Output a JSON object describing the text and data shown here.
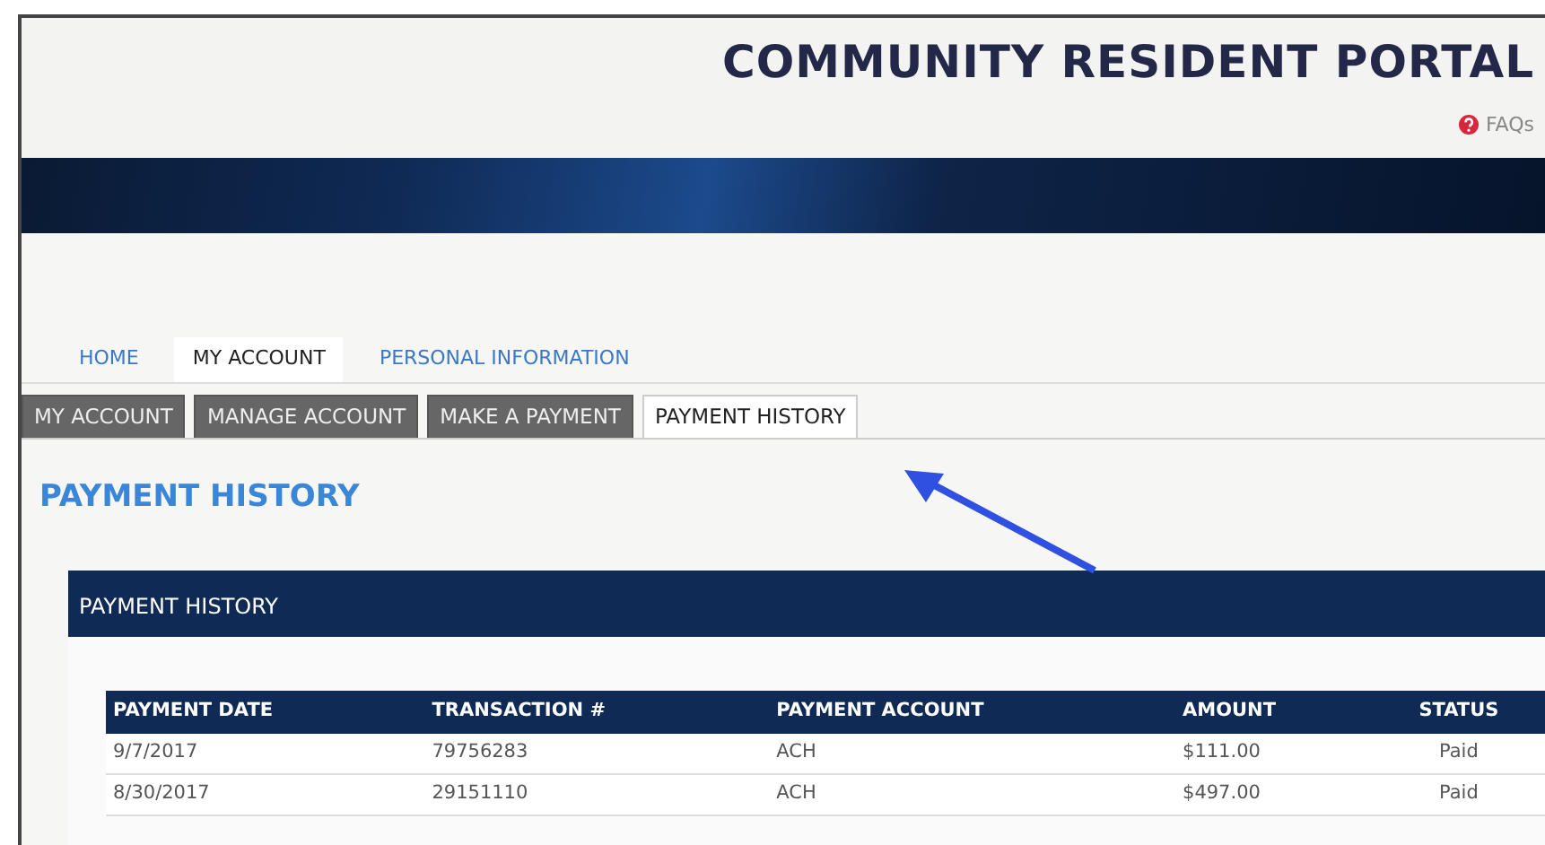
{
  "header": {
    "title": "COMMUNITY RESIDENT PORTAL",
    "faq_link": "FAQs"
  },
  "main_nav": [
    {
      "label": "HOME",
      "selected": false
    },
    {
      "label": "MY ACCOUNT",
      "selected": true
    },
    {
      "label": "PERSONAL INFORMATION",
      "selected": false
    }
  ],
  "sub_tabs": [
    {
      "label": "MY ACCOUNT",
      "selected": false
    },
    {
      "label": "MANAGE ACCOUNT",
      "selected": false
    },
    {
      "label": "MAKE A PAYMENT",
      "selected": false
    },
    {
      "label": "PAYMENT HISTORY",
      "selected": true
    }
  ],
  "page_heading": "PAYMENT HISTORY",
  "panel": {
    "title": "PAYMENT HISTORY",
    "table": {
      "columns": [
        "PAYMENT DATE",
        "TRANSACTION #",
        "PAYMENT ACCOUNT",
        "AMOUNT",
        "STATUS"
      ],
      "rows": [
        [
          "9/7/2017",
          "79756283",
          "ACH",
          "$111.00",
          "Paid"
        ],
        [
          "8/30/2017",
          "29151110",
          "ACH",
          "$497.00",
          "Paid"
        ]
      ]
    }
  }
}
